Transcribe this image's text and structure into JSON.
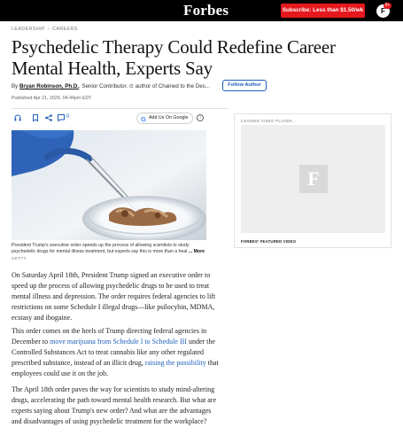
{
  "header": {
    "brand": "Forbes",
    "subscribe_label": "Subscribe: Less than $1.50/wk",
    "avatar_letter": "F",
    "notification_count": "9+"
  },
  "breadcrumb": [
    "LEADERSHIP",
    "CAREERS"
  ],
  "article": {
    "title": "Psychedelic Therapy Could Redefine Career Mental Health, Experts Say",
    "byline_prefix": "By",
    "author": "Bryan Robinson, Ph.D.",
    "author_role": ", Senior Contributor. ⊙ author of Chained to the Des...",
    "follow_label": "Follow Author",
    "published": "Published Apr 21, 2026, 04:44pm EDT",
    "comment_count": "0",
    "google_button": "Add Us On Google",
    "caption": "President Trump's executive order speeds up the process of allowing scientists to study psychedelic drugs for mental illness treatment, but experts say this is more than a heal",
    "caption_more": "... More",
    "photo_credit": "GETTY",
    "paragraphs": [
      {
        "text": "On Saturday April 18th, President Trump signed an executive order to speed up the process of allowing psychedelic drugs to be used to treat mental illness and depression. The order requires federal agencies to lift restrictions on some Schedule I illegal drugs—like psilocybin, MDMA, ecstasy and ibogaine."
      },
      {
        "before": "This order comes on the heels of Trump directing federal agencies in December to ",
        "link1": "move marijuana from Schedule I to Schedule III",
        "middle": " under the Controlled Substances Act to treat cannabis like any other regulated prescribed substance, instead of an illicit drug, ",
        "link2": "raising the possibility",
        "after": " that employees could use it on the job."
      },
      {
        "text": "The April 18th order paves the way for scientists to study mind-altering drugs, accelerating the path toward mental health research. But what are experts saying about Trump's new order? And what are the advantages and disadvantages of using psychedelic treatment for the workplace?"
      }
    ]
  },
  "video": {
    "label": "LOADING VIDEO PLAYER...",
    "logo_letter": "F",
    "featured_label": "FORBES' FEATURED VIDEO"
  },
  "icons": [
    "headphones-icon",
    "bookmark-icon",
    "share-icon",
    "comment-icon",
    "google-logo-icon",
    "info-icon"
  ],
  "colors": {
    "brand_bar": "#000000",
    "subscribe": "#e5181d",
    "link": "#1e5fba"
  }
}
